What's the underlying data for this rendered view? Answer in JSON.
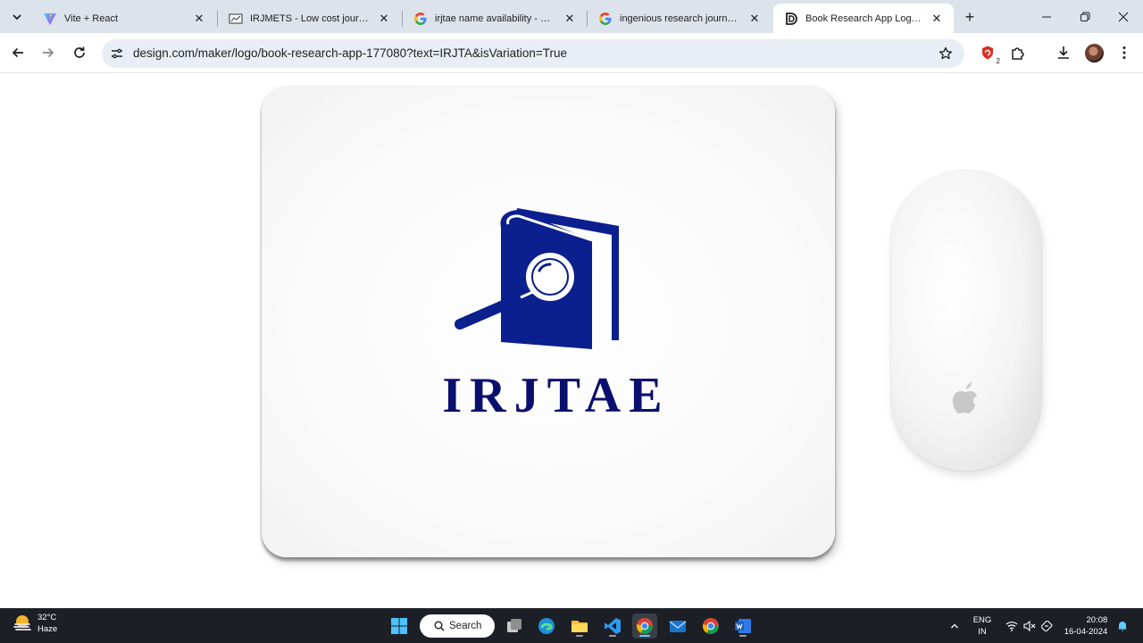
{
  "browser": {
    "tabs": [
      {
        "title": "Vite + React",
        "favicon": "vite-icon",
        "active": false
      },
      {
        "title": "IRJMETS - Low cost journal with",
        "favicon": "irjmets-icon",
        "active": false
      },
      {
        "title": "irjtae name availability - Goog",
        "favicon": "google-icon",
        "active": false
      },
      {
        "title": "ingenious research journal for",
        "favicon": "google-icon",
        "active": false
      },
      {
        "title": "Book Research App Logo | De",
        "favicon": "design-com-icon",
        "active": true
      }
    ],
    "new_tab_label": "+",
    "url": "design.com/maker/logo/book-research-app-177080?text=IRJTA&isVariation=True",
    "extension_badge": "2"
  },
  "page": {
    "logo_text": "IRJTAE",
    "colors": {
      "logo_blue": "#0a1a8a",
      "text_navy": "#0a0f6e"
    }
  },
  "taskbar": {
    "weather": {
      "temp": "32°C",
      "condition": "Haze"
    },
    "search_label": "Search",
    "lang_line1": "ENG",
    "lang_line2": "IN",
    "time": "20:08",
    "date": "16-04-2024"
  }
}
